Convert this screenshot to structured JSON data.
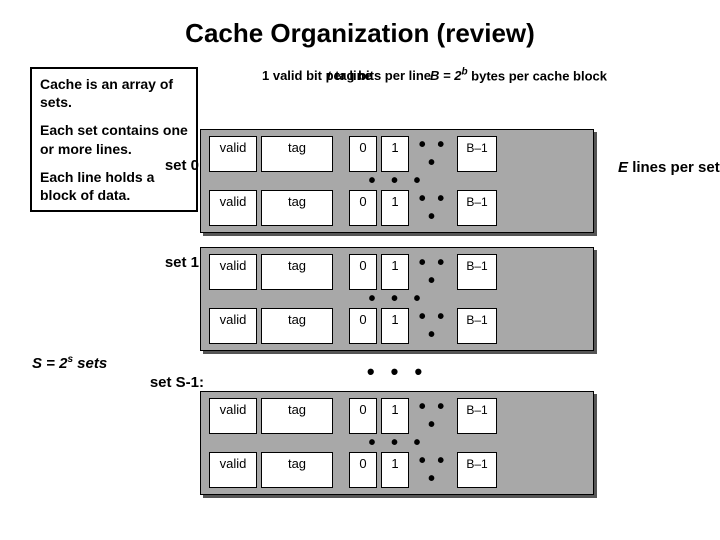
{
  "title": "Cache Organization (review)",
  "leftbox": {
    "p1": "Cache is an array of sets.",
    "p2": "Each set contains one or more lines.",
    "p3": "Each line holds a block of data."
  },
  "headers": {
    "valid": "1 valid bit per line",
    "tag_prefix": "t",
    "tag": " tag bits per line",
    "bytes_prefix": "B = 2",
    "bytes_sup": "b",
    "bytes_suffix": " bytes per cache block"
  },
  "line": {
    "valid": "valid",
    "tag": "tag",
    "b0": "0",
    "b1": "1",
    "dots": "• • •",
    "last": "B–1"
  },
  "sets": {
    "s0": "set 0:",
    "s1": "set 1:",
    "sS": "set S-1:"
  },
  "right_note_prefix": "E ",
  "right_note": " lines per set",
  "s_label_prefix": "S = 2",
  "s_label_sup": "s",
  "s_label_suffix": " sets",
  "vdots": "• • •",
  "chart_data": {
    "type": "table",
    "title": "Cache Organization (review)",
    "annotations": [
      "Cache is an array of sets.",
      "Each set contains one or more lines.",
      "Each line holds a block of data."
    ],
    "parameters": {
      "S": "2^s sets",
      "E": "lines per set",
      "B": "2^b bytes per cache block",
      "t": "tag bits per line",
      "valid_bits": 1
    },
    "line_fields": [
      "valid",
      "tag",
      "byte[0]",
      "byte[1]",
      "...",
      "byte[B-1]"
    ],
    "sets_shown": [
      "set 0",
      "set 1",
      "...",
      "set S-1"
    ]
  }
}
